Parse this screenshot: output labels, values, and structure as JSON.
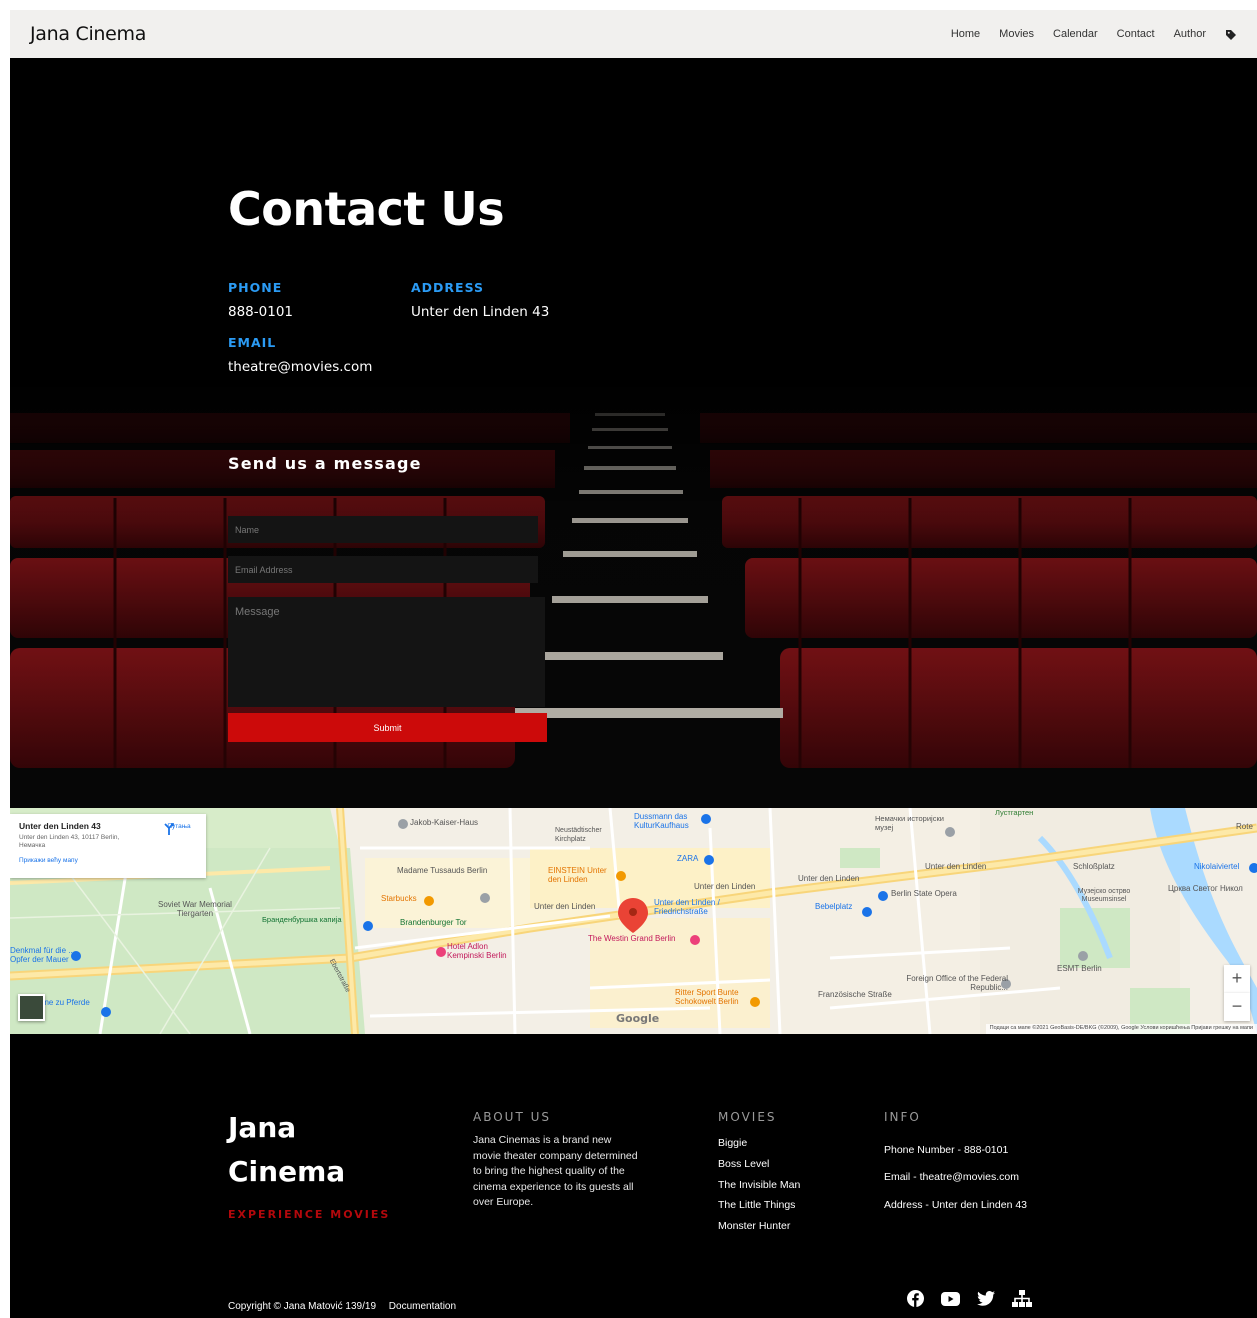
{
  "nav": {
    "brand": "Jana Cinema",
    "items": [
      {
        "label": "Home"
      },
      {
        "label": "Movies"
      },
      {
        "label": "Calendar"
      },
      {
        "label": "Contact"
      },
      {
        "label": "Author"
      }
    ],
    "tag_icon": "tag-icon"
  },
  "hero": {
    "title": "Contact Us",
    "phone_label": "PHONE",
    "phone": "888-0101",
    "address_label": "ADDRESS",
    "address": "Unter den Linden 43",
    "email_label": "EMAIL",
    "email": "theatre@movies.com",
    "form_title": "Send us a message",
    "name_placeholder": "Name",
    "email_placeholder": "Email Address",
    "message_placeholder": "Message",
    "submit_label": "Submit",
    "submit_color": "#cc0a0a",
    "label_color": "#2b9bf4"
  },
  "map": {
    "card_title": "Unter den Linden 43",
    "card_address": "Unter den Linden 43, 10117 Berlin, Немачка",
    "card_link": "Прикажи већу мапу",
    "directions_label": "Путања",
    "labels": {
      "jakob": "Jakob-Kaiser-Haus",
      "dussmann": "Dussmann das KulturKaufhaus",
      "neustadt": "Neustädtischer Kirchplatz",
      "museum": "Немачки историјски музеј",
      "lustgarten": "Лустгартен",
      "tussauds": "Madame Tussauds Berlin",
      "einstein": "EINSTEIN Unter den Linden",
      "zara": "ZARA",
      "starbucks": "Starbucks",
      "sowjet": "Soviet War Memorial Tiergarten",
      "brandenburg_gate_sr": "Бранденбуршка капија",
      "brandenburg_tor": "Brandenburger Tor",
      "udl1": "Unter den Linden",
      "udl2": "Unter den Linden",
      "udl3": "Unter den Linden",
      "udl4": "Unter den Linden",
      "udl_station": "Unter den Linden / Friedrichstraße",
      "adlon": "Hotel Adlon Kempinski Berlin",
      "westin": "The Westin Grand Berlin",
      "opera": "Berlin State Opera",
      "bebelplatz": "Bebelplatz",
      "schlossplatz": "Schloßplatz",
      "museumsinsel": "Музејско острво Museumsinsel",
      "nikolai": "Nikolaiviertel",
      "crkva": "Црква Светог Никол",
      "denkmal": "Denkmal für die ... Opfer der Mauer",
      "pferde": "one zu Pferde",
      "ritter": "Ritter Sport Bunte Schokowelt Berlin",
      "foreign": "Foreign Office of the Federal Republic...",
      "esmt": "ESMT Berlin",
      "franz": "Französische Straße",
      "ebertstrasse": "Ebertstraße",
      "rote": "Rote",
      "google": "Google"
    },
    "zoom_in": "+",
    "zoom_out": "−",
    "attribution": "Подаци са мапе ©2021 GeoBasis-DE/BKG (©2009), Google   Услови коришћења   Пријави грешку на мапи"
  },
  "footer": {
    "brand_line1": "Jana",
    "brand_line2": "Cinema",
    "tagline": "EXPERIENCE MOVIES",
    "about_title": "ABOUT US",
    "about_text": "Jana Cinemas is a brand new movie theater company determined to bring the highest quality of the cinema experience to its guests all over Europe.",
    "movies_title": "MOVIES",
    "movies": [
      {
        "title": "Biggie"
      },
      {
        "title": "Boss Level"
      },
      {
        "title": "The Invisible Man"
      },
      {
        "title": "The Little Things"
      },
      {
        "title": "Monster Hunter"
      }
    ],
    "info_title": "INFO",
    "info": [
      {
        "text": "Phone Number  -  888-0101"
      },
      {
        "text": "Email  -  theatre@movies.com"
      },
      {
        "text": "Address  -  Unter den Linden 43"
      }
    ],
    "copyright": "Copyright © Jana Matović 139/19",
    "documentation": "Documentation",
    "social_icons": [
      "facebook-icon",
      "youtube-icon",
      "twitter-icon",
      "sitemap-icon"
    ]
  }
}
